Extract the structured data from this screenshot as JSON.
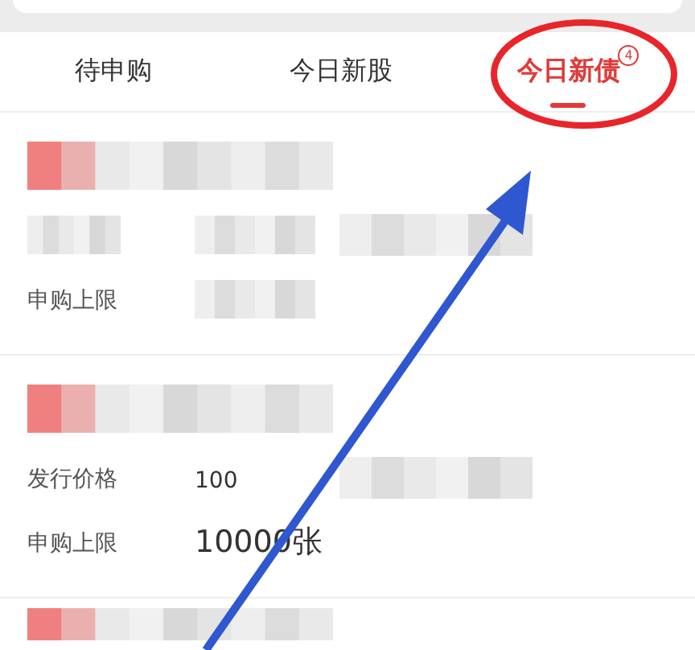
{
  "tabs": [
    {
      "label": "待申购",
      "selected": false
    },
    {
      "label": "今日新股",
      "selected": false
    },
    {
      "label": "今日新债",
      "selected": true,
      "badge": "4"
    }
  ],
  "cards": [
    {
      "rows": [
        [
          {
            "kind": "mosaic"
          },
          {
            "kind": "mosaic"
          },
          {
            "kind": "mosaic"
          }
        ],
        [
          {
            "kind": "label",
            "text": "申购上限"
          },
          {
            "kind": "mosaic"
          }
        ]
      ]
    },
    {
      "rows": [
        [
          {
            "kind": "label",
            "text": "发行价格"
          },
          {
            "kind": "value",
            "text": "100"
          },
          {
            "kind": "mosaic"
          }
        ],
        [
          {
            "kind": "label",
            "text": "申购上限"
          },
          {
            "kind": "big",
            "text": "10000张"
          }
        ]
      ]
    }
  ]
}
